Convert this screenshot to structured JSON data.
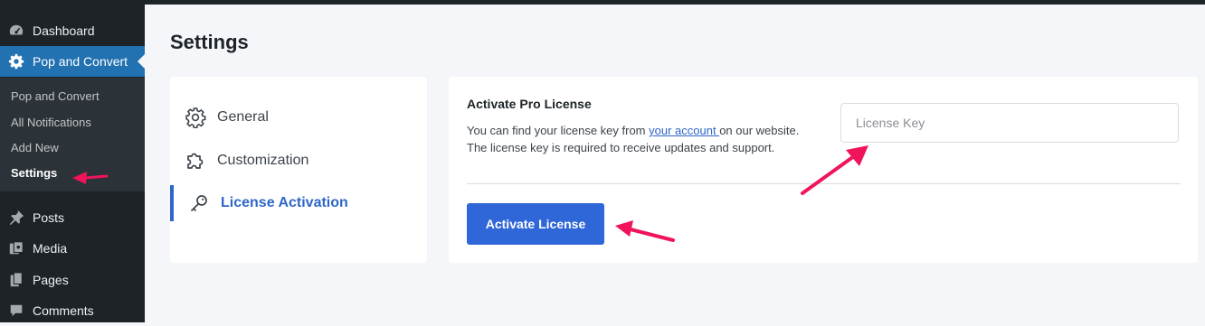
{
  "sidebar": {
    "items": [
      {
        "label": "Dashboard",
        "icon": "dashboard-icon"
      },
      {
        "label": "Pop and Convert",
        "icon": "gear-icon"
      },
      {
        "label": "Posts",
        "icon": "pushpin-icon"
      },
      {
        "label": "Media",
        "icon": "media-icon"
      },
      {
        "label": "Pages",
        "icon": "pages-icon"
      },
      {
        "label": "Comments",
        "icon": "comment-icon"
      }
    ],
    "submenu": [
      "Pop and Convert",
      "All Notifications",
      "Add New",
      "Settings"
    ]
  },
  "main": {
    "title": "Settings",
    "nav": [
      {
        "label": "General",
        "icon": "gear-outline-icon"
      },
      {
        "label": "Customization",
        "icon": "puzzle-icon"
      },
      {
        "label": "License Activation",
        "icon": "key-icon"
      }
    ],
    "license": {
      "heading": "Activate Pro License",
      "line1_prefix": "You can find your license key from ",
      "link_text": "your account ",
      "line1_suffix": "on our website.",
      "line2": "The license key is required to receive updates and support.",
      "input_placeholder": "License Key",
      "button_label": "Activate License"
    }
  },
  "colors": {
    "sidebar_bg": "#1d2327",
    "submenu_bg": "#2c3338",
    "current_menu": "#2271b1",
    "accent": "#2f66d8",
    "annotation_arrow": "#f0145a"
  }
}
